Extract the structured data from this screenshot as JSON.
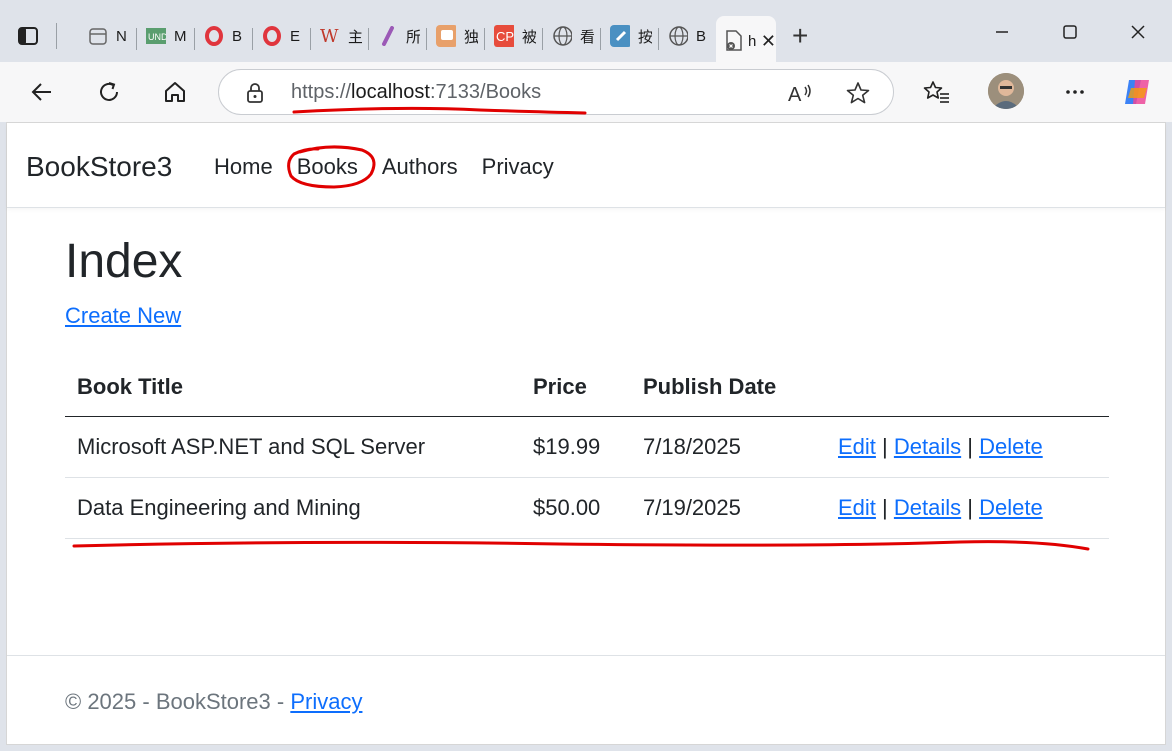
{
  "browser": {
    "tabs": [
      {
        "title": "N",
        "icon": "calendar-icon"
      },
      {
        "title": "M",
        "icon": "und-icon"
      },
      {
        "title": "B",
        "icon": "opera-icon"
      },
      {
        "title": "E",
        "icon": "opera-icon"
      },
      {
        "title": "主",
        "icon": "w-icon"
      },
      {
        "title": "所",
        "icon": "feather-icon"
      },
      {
        "title": "独",
        "icon": "plug-icon"
      },
      {
        "title": "被",
        "icon": "cp-icon"
      },
      {
        "title": "看",
        "icon": "globe-icon"
      },
      {
        "title": "按",
        "icon": "edit-icon"
      },
      {
        "title": "B",
        "icon": "globe-icon"
      }
    ],
    "active_tab": {
      "title": "h",
      "icon": "error-page-icon"
    },
    "address": {
      "scheme": "https://",
      "host": "localhost",
      "rest": ":7133/Books"
    }
  },
  "site": {
    "brand": "BookStore3",
    "nav": [
      "Home",
      "Books",
      "Authors",
      "Privacy"
    ]
  },
  "main": {
    "heading": "Index",
    "create_link": "Create New",
    "table": {
      "headers": [
        "Book Title",
        "Price",
        "Publish Date"
      ],
      "rows": [
        {
          "title": "Microsoft ASP.NET and SQL Server",
          "price": "$19.99",
          "date": "7/18/2025"
        },
        {
          "title": "Data Engineering and Mining",
          "price": "$50.00",
          "date": "7/19/2025"
        }
      ],
      "actions": {
        "edit": "Edit",
        "details": "Details",
        "delete": "Delete",
        "separator": "|"
      }
    }
  },
  "footer": {
    "text": "© 2025 - BookStore3 - ",
    "link": "Privacy"
  },
  "colors": {
    "link": "#0d6efd",
    "annotation": "#e00000",
    "chrome": "#dfe3ea"
  }
}
